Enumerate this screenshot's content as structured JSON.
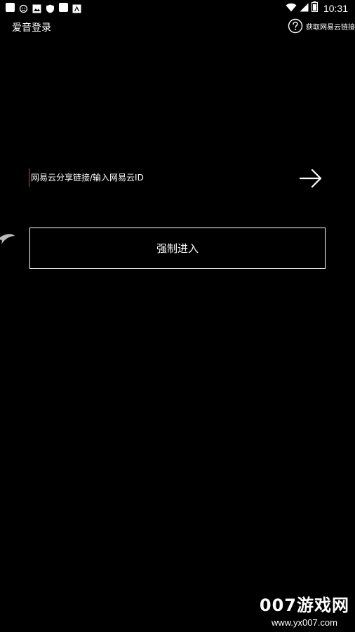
{
  "status_bar": {
    "time": "10:31",
    "left_icons": [
      "app-notification-icon",
      "emoji-notification-icon",
      "image-notification-icon",
      "shield-notification-icon",
      "square-notification-icon",
      "store-notification-icon"
    ],
    "right_icons": [
      "wifi-icon",
      "signal-icon",
      "battery-icon"
    ]
  },
  "header": {
    "title": "爱音登录",
    "help_label": "获取网易云链接",
    "help_icon": "question-circle-icon"
  },
  "input": {
    "placeholder": "网易云分享链接/输入网易云ID",
    "value": "",
    "cursor_color": "#e0403a",
    "submit_icon": "arrow-right-icon"
  },
  "force_button": {
    "label": "强制进入"
  },
  "watermark": {
    "main": "007游戏网",
    "sub": "www.yx007.com"
  },
  "colors": {
    "background": "#000000",
    "foreground": "#ffffff",
    "accent": "#e0403a"
  }
}
